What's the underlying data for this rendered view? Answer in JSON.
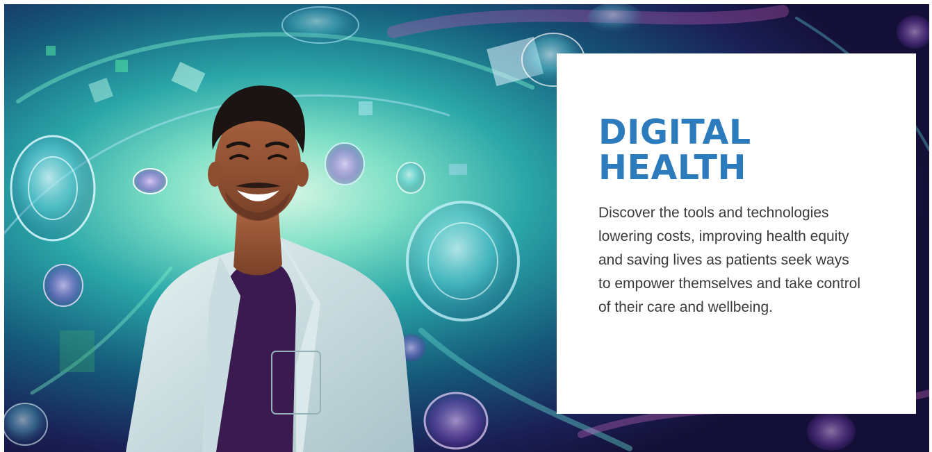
{
  "hero": {
    "image_icon": "smiling-doctor-illustration",
    "title_line1": "DIGITAL",
    "title_line2": "HEALTH",
    "description": "Discover the tools and technologies lowering costs, improving health equity and saving lives as patients seek ways to empower themselves and take control of their care and wellbeing.",
    "title_color": "#2b7bbd",
    "text_color": "#3a3a3a"
  }
}
